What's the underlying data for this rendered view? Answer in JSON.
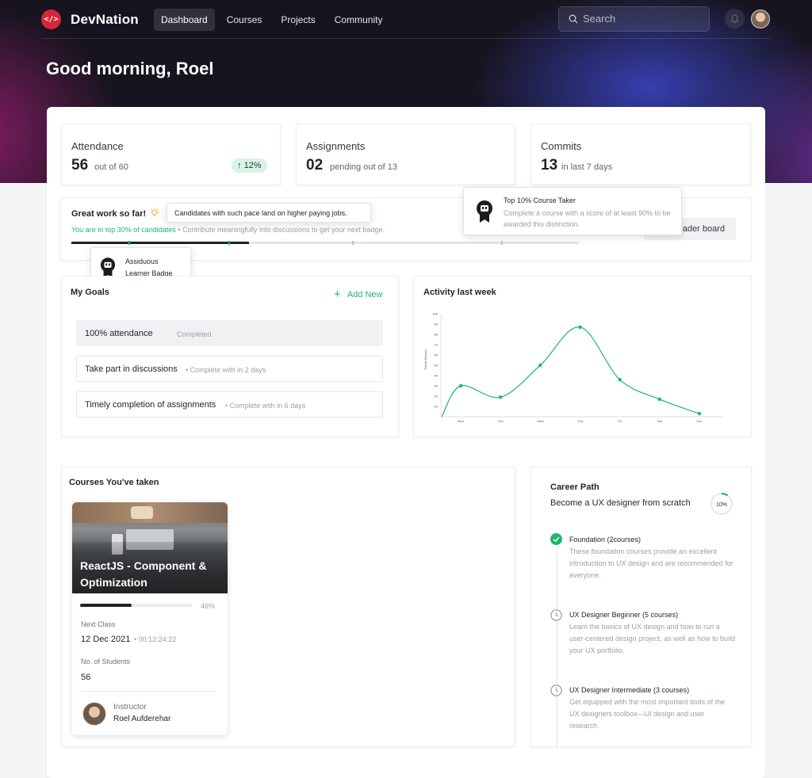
{
  "brand": {
    "name": "DevNation",
    "logo_glyph": "</>"
  },
  "nav": {
    "items": [
      "Dashboard",
      "Courses",
      "Projects",
      "Community"
    ],
    "active": "Dashboard"
  },
  "search": {
    "placeholder": "Search"
  },
  "greeting": "Good morning, Roel",
  "colors": {
    "accent_green": "#22b46e",
    "brand_red": "#d3283a",
    "dark": "#17141f"
  },
  "stats": {
    "attendance": {
      "label": "Attendance",
      "value": "56",
      "sub": "out of 60",
      "change": "12%"
    },
    "assignments": {
      "label": "Assignments",
      "value": "02",
      "sub": "pending out of 13"
    },
    "commits": {
      "label": "Commits",
      "value": "13",
      "sub": "in last 7 days"
    }
  },
  "progress": {
    "title": "Great work so far!",
    "tooltip": "Candidates with such pace land on higher paying jobs.",
    "highlight": "You are in top 30% of candidates",
    "hint": "Contribute meaningfully into discussions to get your next badge.",
    "fill_fraction": 0.35,
    "leaderboard_button": "ader board",
    "badge_left": {
      "line1": "Assiduous",
      "line2": "Learner Badge"
    },
    "badge_right": {
      "title": "Top 10% Course Taker",
      "desc": "Complete a course with a score of at least 90% to be awarded this distinction."
    }
  },
  "goals": {
    "title": "My Goals",
    "add_label": "Add New",
    "items": [
      {
        "title": "100% attendance",
        "status": "Completed"
      },
      {
        "title": "Take part in discussions",
        "status": "Complete with in 2 days"
      },
      {
        "title": "Timely completion of assignments",
        "status": "Complete with in 6 days"
      }
    ]
  },
  "activity": {
    "title": "Activity last week",
    "ylabel": "Points Earned"
  },
  "chart_data": {
    "type": "line",
    "title": "Activity last week",
    "xlabel": "",
    "ylabel": "Points Earned",
    "categories": [
      "Mon",
      "Tue",
      "Wed",
      "Thu",
      "Fri",
      "Sat",
      "Sun"
    ],
    "y_ticks": [
      10,
      20,
      30,
      40,
      50,
      60,
      70,
      80,
      90,
      100
    ],
    "ylim": [
      0,
      100
    ],
    "series": [
      {
        "values": [
          30,
          19,
          50,
          87,
          36,
          17,
          3
        ]
      }
    ],
    "start_value": 0,
    "grid": false,
    "color": "#22b46e"
  },
  "courses": {
    "title": "Courses You've taken",
    "items": [
      {
        "title": "ReactJS - Component & Optimization",
        "progress_label": "46%",
        "progress": 0.46,
        "next_class_label": "Next Class",
        "next_class_date": "12 Dec 2021",
        "next_class_countdown": "00:12:24:22",
        "students_label": "No. of Students",
        "students": "56",
        "instructor_label": "Instructor",
        "instructor": "Roel Aufderehar"
      }
    ]
  },
  "career": {
    "title": "Career Path",
    "subtitle": "Become a UX designer from scratch",
    "progress_label": "10%",
    "progress": 0.1,
    "steps": [
      {
        "title": "Foundation (2courses)",
        "desc": "These foundation courses provide an excellent introduction to UX design and are recommended for everyone.",
        "icon": "check-circle-icon"
      },
      {
        "title": "UX Designer Beginner (5 courses)",
        "desc": "Learn the basics of UX design and how to run a user-centered design project, as well as how to build your UX portfolio.",
        "icon": "clock-icon"
      },
      {
        "title": "UX Designer Intermediate (3 courses)",
        "desc": "Get equipped with the most important tools of the UX designers toolbox—UI design and user research.",
        "icon": "clock-icon"
      }
    ]
  }
}
